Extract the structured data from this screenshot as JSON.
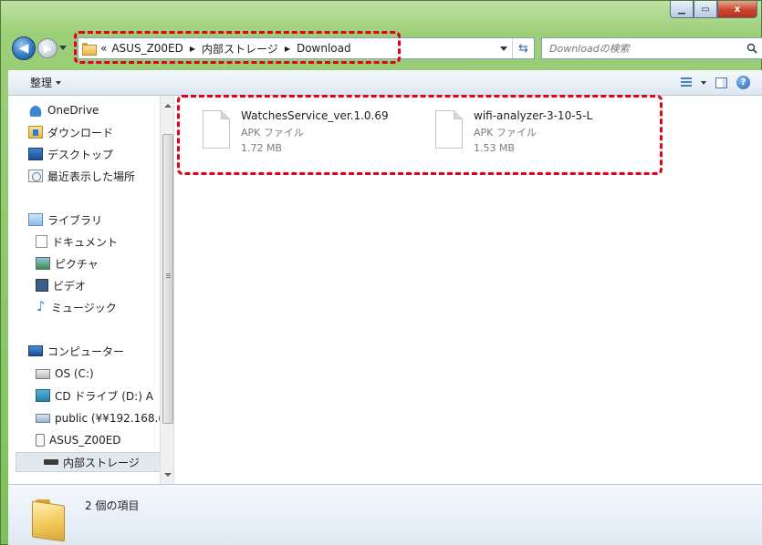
{
  "window": {
    "minimize": "▁",
    "maximize": "▭",
    "close": "x"
  },
  "address": {
    "lead": "«",
    "crumbs": [
      "ASUS_Z00ED",
      "内部ストレージ",
      "Download"
    ]
  },
  "search": {
    "placeholder": "Downloadの検索"
  },
  "toolbar": {
    "organize_label": "整理"
  },
  "sidebar": {
    "items": [
      {
        "label": "OneDrive",
        "icon": "cloud-icon"
      },
      {
        "label": "ダウンロード",
        "icon": "downloads-folder-icon"
      },
      {
        "label": "デスクトップ",
        "icon": "desktop-icon"
      },
      {
        "label": "最近表示した場所",
        "icon": "recent-places-icon"
      },
      {
        "label": "ライブラリ",
        "icon": "library-icon"
      },
      {
        "label": "ドキュメント",
        "icon": "documents-icon"
      },
      {
        "label": "ピクチャ",
        "icon": "pictures-icon"
      },
      {
        "label": "ビデオ",
        "icon": "videos-icon"
      },
      {
        "label": "ミュージック",
        "icon": "music-icon"
      },
      {
        "label": "コンピューター",
        "icon": "computer-icon"
      },
      {
        "label": "OS (C:)",
        "icon": "hard-drive-icon"
      },
      {
        "label": "CD ドライブ (D:) A",
        "icon": "cd-drive-icon"
      },
      {
        "label": "public (¥¥192.168.(",
        "icon": "network-drive-icon"
      },
      {
        "label": "ASUS_Z00ED",
        "icon": "portable-device-icon"
      },
      {
        "label": "内部ストレージ",
        "icon": "storage-icon"
      }
    ]
  },
  "files": [
    {
      "name": "WatchesService_ver.1.0.69",
      "type": "APK ファイル",
      "size": "1.72 MB"
    },
    {
      "name": "wifi-analyzer-3-10-5-L",
      "type": "APK ファイル",
      "size": "1.53 MB"
    }
  ],
  "details": {
    "item_count": "2 個の項目"
  },
  "colors": {
    "highlight": "#e3001b",
    "window_frame": "#7fbf5a"
  }
}
